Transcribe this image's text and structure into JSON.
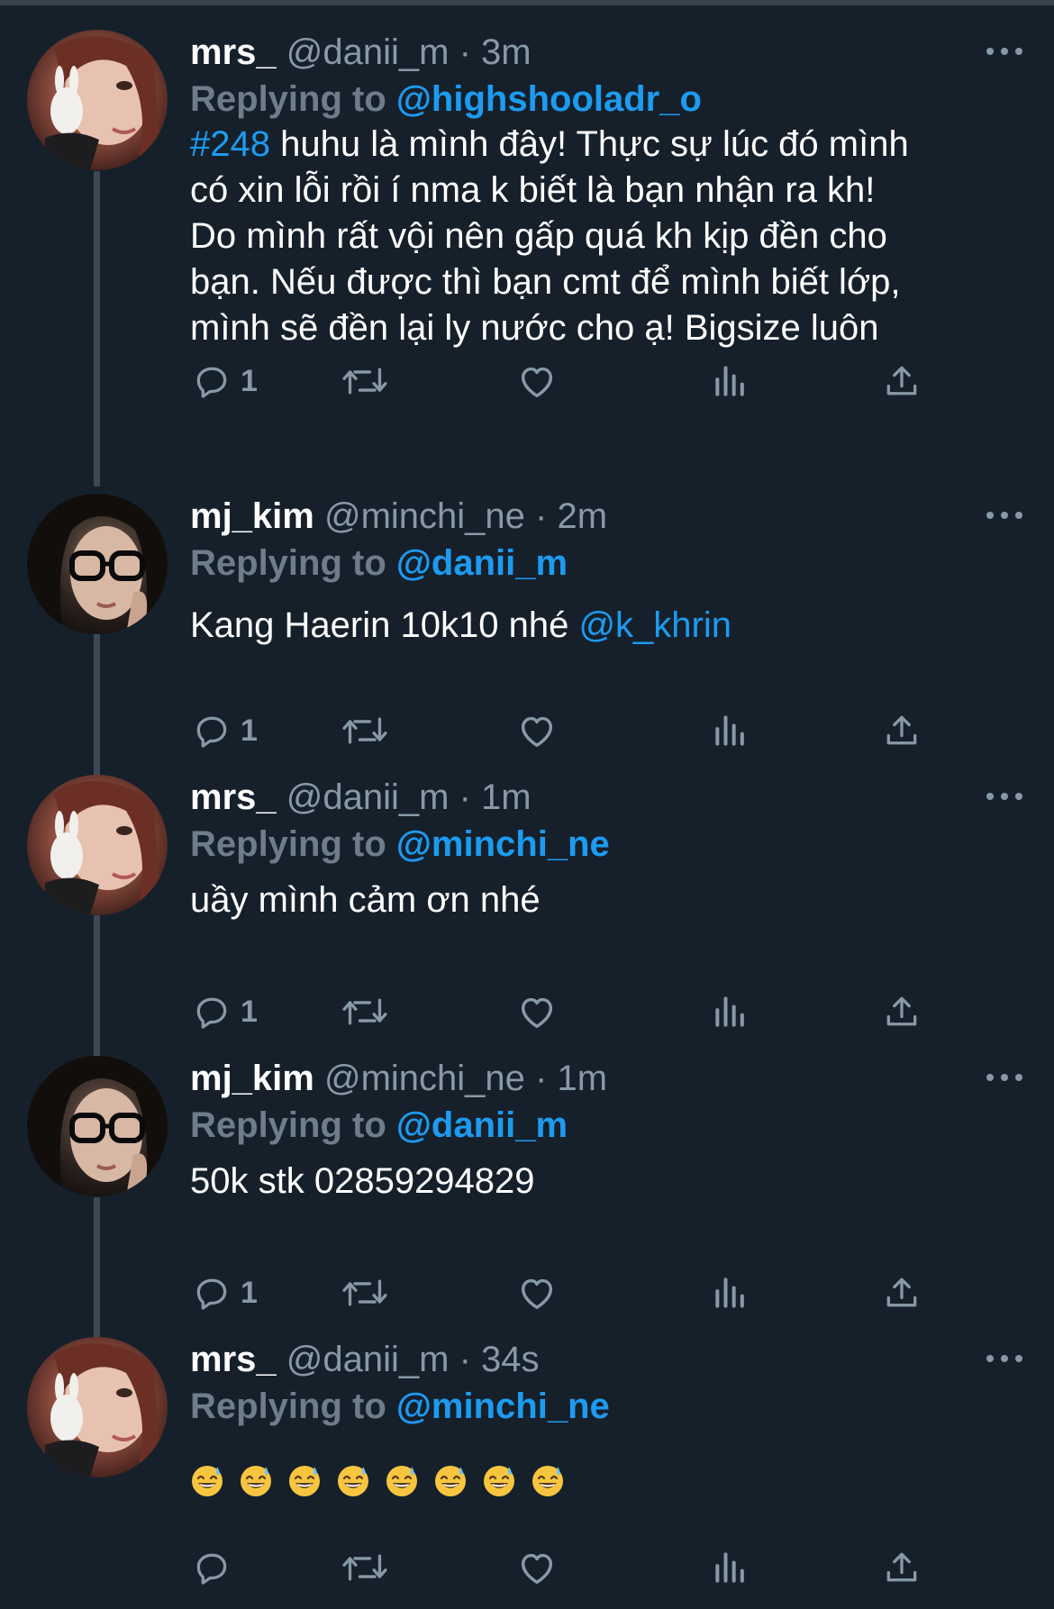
{
  "colors": {
    "background": "#15202b",
    "accent": "#1d9bf0",
    "muted": "#8899a6",
    "thread_line": "#3d4a55"
  },
  "tweets": [
    {
      "display_name": "mrs_",
      "handle": "@danii_m",
      "separator": "·",
      "time": "3m",
      "replying_prefix": "Replying to",
      "replying_to": "@highshooladr_o",
      "text_hashtag": "#248",
      "text": " huhu là mình đây! Thực sự lúc đó mình\ncó xin lỗi rồi í nma k biết là bạn nhận ra kh!\nDo mình rất vội nên gấp quá kh kịp đền cho\nbạn. Nếu được thì bạn cmt để mình biết lớp,\nmình sẽ đền lại ly nước cho ạ! Bigsize luôn",
      "reply_count": "1",
      "avatar": "avatar-mrs"
    },
    {
      "display_name": "mj_kim",
      "handle": "@minchi_ne",
      "separator": "·",
      "time": "2m",
      "replying_prefix": "Replying to",
      "replying_to": "@danii_m",
      "text": "Kang Haerin 10k10 nhé ",
      "text_mention": "@k_khrin",
      "reply_count": "1",
      "avatar": "avatar-mjkim"
    },
    {
      "display_name": "mrs_",
      "handle": "@danii_m",
      "separator": "·",
      "time": "1m",
      "replying_prefix": "Replying to",
      "replying_to": "@minchi_ne",
      "text": "uầy mình cảm ơn nhé",
      "reply_count": "1",
      "avatar": "avatar-mrs"
    },
    {
      "display_name": "mj_kim",
      "handle": "@minchi_ne",
      "separator": "·",
      "time": "1m",
      "replying_prefix": "Replying to",
      "replying_to": "@danii_m",
      "text": "50k stk 02859294829",
      "reply_count": "1",
      "avatar": "avatar-mjkim"
    },
    {
      "display_name": "mrs_",
      "handle": "@danii_m",
      "separator": "·",
      "time": "34s",
      "replying_prefix": "Replying to",
      "replying_to": "@minchi_ne",
      "emoji": [
        "😅",
        "😅",
        "😅",
        "😅",
        "😅",
        "😅",
        "😅",
        "😅"
      ],
      "reply_count": "",
      "avatar": "avatar-mrs"
    }
  ],
  "icons": {
    "reply": "reply-icon",
    "retweet": "retweet-icon",
    "like": "heart-icon",
    "analytics": "analytics-icon",
    "share": "share-icon",
    "more": "more-icon"
  }
}
